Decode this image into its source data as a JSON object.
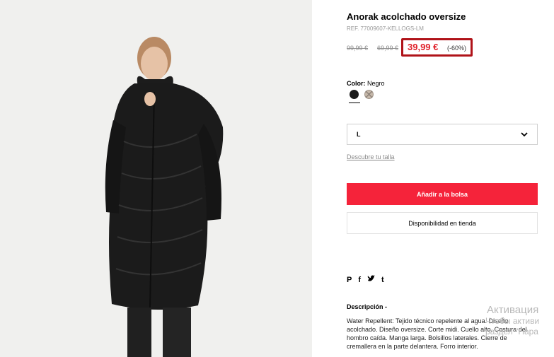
{
  "product": {
    "title": "Anorak acolchado oversize",
    "ref": "REF. 77009607-KELLOGS-LM",
    "price_original_1": "99,99 €",
    "price_original_2": "69,99 €",
    "price_current": "39,99 €",
    "discount": "(-60%)",
    "color_label": "Color:",
    "color_value": "Negro",
    "colors": [
      {
        "name": "black-swatch",
        "hex": "#1a1a1a"
      },
      {
        "name": "beige-swatch",
        "hex": "#c6b8aa"
      }
    ],
    "size_selected": "L",
    "size_guide_link": "Descubre tu talla",
    "add_to_bag": "Añadir a la bolsa",
    "store_availability": "Disponibilidad en tienda",
    "social_icons": [
      "pinterest-icon",
      "facebook-icon",
      "twitter-icon",
      "tumblr-icon"
    ],
    "description_title": "Descripción -",
    "description_text": "Water Repellent: Tejido técnico repelente al agua. Diseño acolchado. Diseño oversize. Corte midi. Cuello alto. Costura del hombro caída. Manga larga. Bolsillos laterales. Cierre de cremallera en la parte delantera. Forro interior."
  },
  "watermark": {
    "line1": "Активация",
    "line2": "Чтобы активи",
    "line3": "раздел \"Пара"
  },
  "colors": {
    "accent": "#f5233a",
    "highlight_border": "#b01319",
    "price_red": "#e0212a"
  }
}
